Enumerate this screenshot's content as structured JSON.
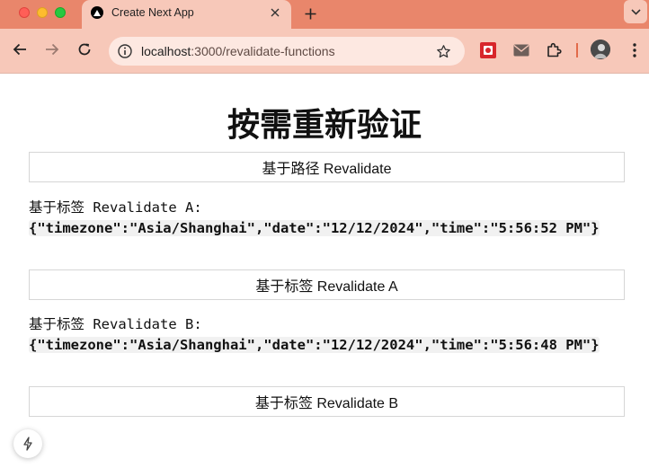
{
  "browser": {
    "tab": {
      "title": "Create Next App"
    },
    "url": {
      "host": "localhost",
      "path": ":3000/revalidate-functions"
    }
  },
  "page": {
    "heading": "按需重新验证",
    "path_button_label": "基于路径 Revalidate",
    "tag_a": {
      "label": "基于标签 Revalidate A:",
      "json": "{\"timezone\":\"Asia/Shanghai\",\"date\":\"12/12/2024\",\"time\":\"5:56:52 PM\"}",
      "button_label": "基于标签 Revalidate A"
    },
    "tag_b": {
      "label": "基于标签 Revalidate B:",
      "json": "{\"timezone\":\"Asia/Shanghai\",\"date\":\"12/12/2024\",\"time\":\"5:56:48 PM\"}",
      "button_label": "基于标签 Revalidate B"
    }
  },
  "icons": {
    "tab_favicon": "nextjs-triangle-icon",
    "dev_indicator": "lightning-bolt-icon"
  },
  "colors": {
    "tab_strip": "#e9866b",
    "toolbar": "#f7c8b9",
    "omnibox": "#fde8e1"
  }
}
